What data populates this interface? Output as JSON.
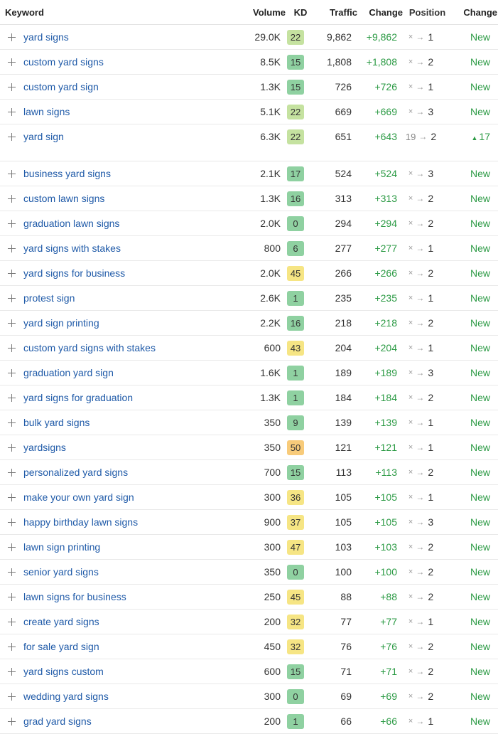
{
  "headers": {
    "keyword": "Keyword",
    "volume": "Volume",
    "kd": "KD",
    "traffic": "Traffic",
    "change": "Change",
    "position": "Position",
    "position_change": "Change"
  },
  "kd_colors": {
    "green": "#8fd1a1",
    "lime": "#c5e2a0",
    "yellow": "#f6e584",
    "orange": "#f8cb7a"
  },
  "rows": [
    {
      "keyword": "yard signs",
      "volume": "29.0K",
      "kd": "22",
      "kd_level": "lime",
      "traffic": "9,862",
      "change": "+9,862",
      "pos_from": "×",
      "pos_to": "1",
      "pos_change": "New"
    },
    {
      "keyword": "custom yard signs",
      "volume": "8.5K",
      "kd": "15",
      "kd_level": "green",
      "traffic": "1,808",
      "change": "+1,808",
      "pos_from": "×",
      "pos_to": "2",
      "pos_change": "New"
    },
    {
      "keyword": "custom yard sign",
      "volume": "1.3K",
      "kd": "15",
      "kd_level": "green",
      "traffic": "726",
      "change": "+726",
      "pos_from": "×",
      "pos_to": "1",
      "pos_change": "New"
    },
    {
      "keyword": "lawn signs",
      "volume": "5.1K",
      "kd": "22",
      "kd_level": "lime",
      "traffic": "669",
      "change": "+669",
      "pos_from": "×",
      "pos_to": "3",
      "pos_change": "New"
    },
    {
      "keyword": "yard sign",
      "volume": "6.3K",
      "kd": "22",
      "kd_level": "lime",
      "traffic": "651",
      "change": "+643",
      "pos_from": "19",
      "pos_to": "2",
      "pos_change": "▲17"
    },
    {
      "keyword": "business yard signs",
      "volume": "2.1K",
      "kd": "17",
      "kd_level": "green",
      "traffic": "524",
      "change": "+524",
      "pos_from": "×",
      "pos_to": "3",
      "pos_change": "New"
    },
    {
      "keyword": "custom lawn signs",
      "volume": "1.3K",
      "kd": "16",
      "kd_level": "green",
      "traffic": "313",
      "change": "+313",
      "pos_from": "×",
      "pos_to": "2",
      "pos_change": "New"
    },
    {
      "keyword": "graduation lawn signs",
      "volume": "2.0K",
      "kd": "0",
      "kd_level": "green",
      "traffic": "294",
      "change": "+294",
      "pos_from": "×",
      "pos_to": "2",
      "pos_change": "New"
    },
    {
      "keyword": "yard signs with stakes",
      "volume": "800",
      "kd": "6",
      "kd_level": "green",
      "traffic": "277",
      "change": "+277",
      "pos_from": "×",
      "pos_to": "1",
      "pos_change": "New"
    },
    {
      "keyword": "yard signs for business",
      "volume": "2.0K",
      "kd": "45",
      "kd_level": "yellow",
      "traffic": "266",
      "change": "+266",
      "pos_from": "×",
      "pos_to": "2",
      "pos_change": "New"
    },
    {
      "keyword": "protest sign",
      "volume": "2.6K",
      "kd": "1",
      "kd_level": "green",
      "traffic": "235",
      "change": "+235",
      "pos_from": "×",
      "pos_to": "1",
      "pos_change": "New"
    },
    {
      "keyword": "yard sign printing",
      "volume": "2.2K",
      "kd": "16",
      "kd_level": "green",
      "traffic": "218",
      "change": "+218",
      "pos_from": "×",
      "pos_to": "2",
      "pos_change": "New"
    },
    {
      "keyword": "custom yard signs with stakes",
      "volume": "600",
      "kd": "43",
      "kd_level": "yellow",
      "traffic": "204",
      "change": "+204",
      "pos_from": "×",
      "pos_to": "1",
      "pos_change": "New"
    },
    {
      "keyword": "graduation yard sign",
      "volume": "1.6K",
      "kd": "1",
      "kd_level": "green",
      "traffic": "189",
      "change": "+189",
      "pos_from": "×",
      "pos_to": "3",
      "pos_change": "New"
    },
    {
      "keyword": "yard signs for graduation",
      "volume": "1.3K",
      "kd": "1",
      "kd_level": "green",
      "traffic": "184",
      "change": "+184",
      "pos_from": "×",
      "pos_to": "2",
      "pos_change": "New"
    },
    {
      "keyword": "bulk yard signs",
      "volume": "350",
      "kd": "9",
      "kd_level": "green",
      "traffic": "139",
      "change": "+139",
      "pos_from": "×",
      "pos_to": "1",
      "pos_change": "New"
    },
    {
      "keyword": "yardsigns",
      "volume": "350",
      "kd": "50",
      "kd_level": "orange",
      "traffic": "121",
      "change": "+121",
      "pos_from": "×",
      "pos_to": "1",
      "pos_change": "New"
    },
    {
      "keyword": "personalized yard signs",
      "volume": "700",
      "kd": "15",
      "kd_level": "green",
      "traffic": "113",
      "change": "+113",
      "pos_from": "×",
      "pos_to": "2",
      "pos_change": "New"
    },
    {
      "keyword": "make your own yard sign",
      "volume": "300",
      "kd": "36",
      "kd_level": "yellow",
      "traffic": "105",
      "change": "+105",
      "pos_from": "×",
      "pos_to": "1",
      "pos_change": "New"
    },
    {
      "keyword": "happy birthday lawn signs",
      "volume": "900",
      "kd": "37",
      "kd_level": "yellow",
      "traffic": "105",
      "change": "+105",
      "pos_from": "×",
      "pos_to": "3",
      "pos_change": "New"
    },
    {
      "keyword": "lawn sign printing",
      "volume": "300",
      "kd": "47",
      "kd_level": "yellow",
      "traffic": "103",
      "change": "+103",
      "pos_from": "×",
      "pos_to": "2",
      "pos_change": "New"
    },
    {
      "keyword": "senior yard signs",
      "volume": "350",
      "kd": "0",
      "kd_level": "green",
      "traffic": "100",
      "change": "+100",
      "pos_from": "×",
      "pos_to": "2",
      "pos_change": "New"
    },
    {
      "keyword": "lawn signs for business",
      "volume": "250",
      "kd": "45",
      "kd_level": "yellow",
      "traffic": "88",
      "change": "+88",
      "pos_from": "×",
      "pos_to": "2",
      "pos_change": "New"
    },
    {
      "keyword": "create yard signs",
      "volume": "200",
      "kd": "32",
      "kd_level": "yellow",
      "traffic": "77",
      "change": "+77",
      "pos_from": "×",
      "pos_to": "1",
      "pos_change": "New"
    },
    {
      "keyword": "for sale yard sign",
      "volume": "450",
      "kd": "32",
      "kd_level": "yellow",
      "traffic": "76",
      "change": "+76",
      "pos_from": "×",
      "pos_to": "2",
      "pos_change": "New"
    },
    {
      "keyword": "yard signs custom",
      "volume": "600",
      "kd": "15",
      "kd_level": "green",
      "traffic": "71",
      "change": "+71",
      "pos_from": "×",
      "pos_to": "2",
      "pos_change": "New"
    },
    {
      "keyword": "wedding yard signs",
      "volume": "300",
      "kd": "0",
      "kd_level": "green",
      "traffic": "69",
      "change": "+69",
      "pos_from": "×",
      "pos_to": "2",
      "pos_change": "New"
    },
    {
      "keyword": "grad yard signs",
      "volume": "200",
      "kd": "1",
      "kd_level": "green",
      "traffic": "66",
      "change": "+66",
      "pos_from": "×",
      "pos_to": "1",
      "pos_change": "New"
    }
  ]
}
